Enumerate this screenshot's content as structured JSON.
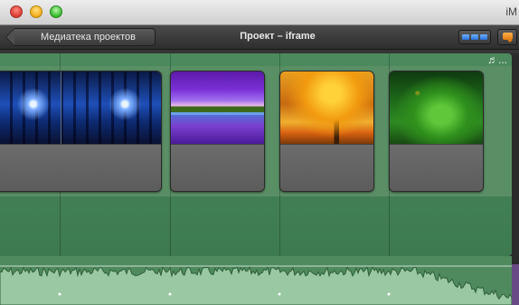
{
  "window": {
    "app_title": "iM"
  },
  "toolbar": {
    "back_label": "Медиатека проектов",
    "project_title": "Проект – iframe"
  },
  "clips": [
    {
      "name": "clip-forest-night",
      "theme": "forest"
    },
    {
      "name": "clip-purple-lake",
      "theme": "lake"
    },
    {
      "name": "clip-autumn-tree",
      "theme": "autumn"
    },
    {
      "name": "clip-moss-tree",
      "theme": "moss"
    }
  ],
  "music": {
    "icon": "music-note-icon",
    "label": "♬..."
  },
  "colors": {
    "strip": "#4c8a5e",
    "audio_wave": "#2f5f3a",
    "audio_fill": "#9ac8a2",
    "view_button": "#2a6fd8",
    "comment_button": "#e07a10"
  }
}
